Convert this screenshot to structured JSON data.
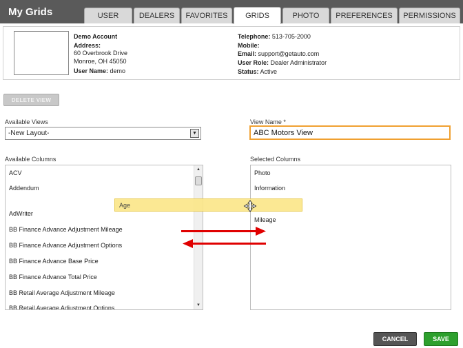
{
  "app": {
    "title": "My Grids"
  },
  "tabs": [
    {
      "label": "USER"
    },
    {
      "label": "DEALERS"
    },
    {
      "label": "FAVORITES"
    },
    {
      "label": "GRIDS"
    },
    {
      "label": "PHOTO"
    },
    {
      "label": "PREFERENCES"
    },
    {
      "label": "PERMISSIONS"
    }
  ],
  "active_tab": "GRIDS",
  "profile": {
    "account": "Demo Account",
    "address_label": "Address:",
    "address_line1": "60 Overbrook Drive",
    "address_line2": "Monroe, OH 45050",
    "username_label": "User Name:",
    "username": "demo",
    "telephone_label": "Telephone:",
    "telephone": "513-705-2000",
    "mobile_label": "Mobile:",
    "mobile": "",
    "email_label": "Email:",
    "email": "support@getauto.com",
    "role_label": "User Role:",
    "role": "Dealer Administrator",
    "status_label": "Status:",
    "status": "Active"
  },
  "toolbar": {
    "delete_label": "DELETE VIEW"
  },
  "views": {
    "available_label": "Available Views",
    "selected_value": "-New Layout-",
    "name_label": "View Name *",
    "name_value": "ABC Motors View"
  },
  "available_columns": {
    "label": "Available Columns",
    "items": [
      "ACV",
      "Addendum",
      "AdWriter",
      "BB Finance Advance Adjustment Mileage",
      "BB Finance Advance Adjustment Options",
      "BB Finance Advance Base Price",
      "BB Finance Advance Total Price",
      "BB Retail Average Adjustment Mileage",
      "BB Retail Average Adjustment Options"
    ]
  },
  "selected_columns": {
    "label": "Selected Columns",
    "items": [
      "Photo",
      "Information",
      "Mileage"
    ]
  },
  "dragging": {
    "label": "Age"
  },
  "icons": {
    "move": "move-cursor-icon",
    "arrow_right": "arrow-right-icon",
    "arrow_left": "arrow-left-icon",
    "dropdown": "chevron-down-icon"
  },
  "colors": {
    "header": "#5a5a5a",
    "drag_highlight": "#fbe78a",
    "focus_border": "#f0a030",
    "arrow": "#e00000",
    "save": "#2ea02e",
    "cancel": "#555555"
  },
  "actions": {
    "cancel_label": "CANCEL",
    "save_label": "SAVE"
  }
}
